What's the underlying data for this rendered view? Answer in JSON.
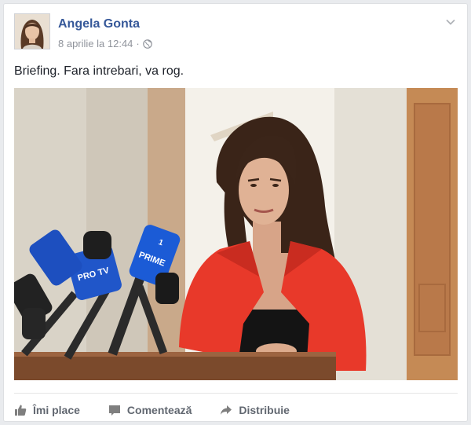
{
  "post": {
    "author": "Angela Gonta",
    "timestamp": "8 aprilie la 12:44",
    "separator": "·",
    "privacy_icon": "globe-icon",
    "text": "Briefing. Fara intrebari, va rog."
  },
  "actions": {
    "like_label": "Îmi place",
    "comment_label": "Comentează",
    "share_label": "Distribuie"
  },
  "photo_logos": [
    "PRO TV",
    "PRIME",
    "1"
  ],
  "colors": {
    "author_link": "#365899",
    "jacket": "#e8392a",
    "mic_blue": "#1b5bd6",
    "action_text": "#616770"
  }
}
